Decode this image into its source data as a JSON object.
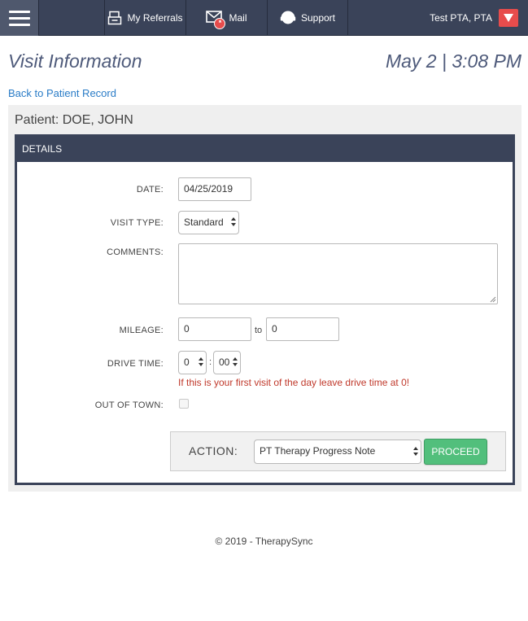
{
  "navbar": {
    "referrals_label": "My Referrals",
    "mail_label": "Mail",
    "mail_badge": "*",
    "support_label": "Support",
    "user_label": "Test PTA, PTA",
    "colors": {
      "bar": "#3a4359",
      "badge": "#e74c4c"
    }
  },
  "header": {
    "title": "Visit Information",
    "datetime": "May 2 | 3:08 PM",
    "back_link": "Back to Patient Record"
  },
  "patient": {
    "label": "Patient: DOE, JOHN"
  },
  "details": {
    "heading": "DETAILS",
    "date": {
      "label": "DATE:",
      "value": "04/25/2019"
    },
    "visit_type": {
      "label": "VISIT TYPE:",
      "value": "Standard"
    },
    "comments": {
      "label": "COMMENTS:",
      "value": ""
    },
    "mileage": {
      "label": "MILEAGE:",
      "from": "0",
      "to_label": "to",
      "to": "0"
    },
    "drive_time": {
      "label": "DRIVE TIME:",
      "hours": "0",
      "separator": ":",
      "minutes": "00",
      "warning": "If this is your first visit of the day leave drive time at 0!"
    },
    "out_of_town": {
      "label": "OUT OF TOWN:",
      "checked": false
    }
  },
  "action": {
    "label": "ACTION:",
    "selected": "PT Therapy Progress Note",
    "proceed_label": "PROCEED",
    "proceed_color": "#52bf7c"
  },
  "footer": {
    "copyright": "© 2019 - TherapySync"
  }
}
